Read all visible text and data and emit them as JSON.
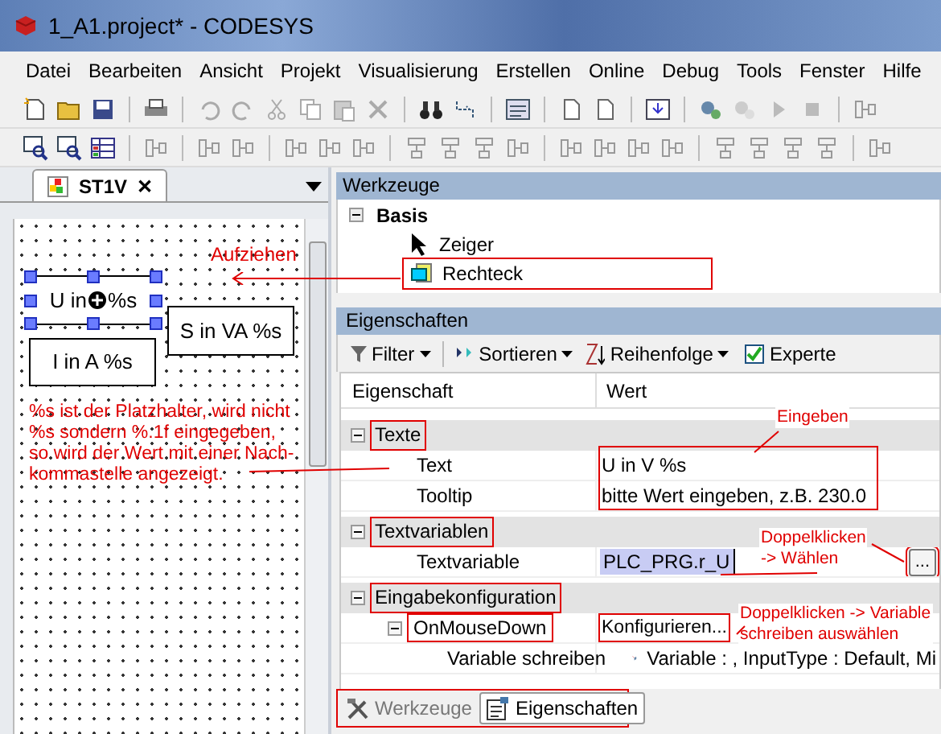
{
  "window": {
    "title": "1_A1.project* - CODESYS"
  },
  "menu": [
    {
      "label": "Datei"
    },
    {
      "label": "Bearbeiten"
    },
    {
      "label": "Ansicht"
    },
    {
      "label": "Projekt"
    },
    {
      "label": "Visualisierung"
    },
    {
      "label": "Erstellen"
    },
    {
      "label": "Online"
    },
    {
      "label": "Debug"
    },
    {
      "label": "Tools"
    },
    {
      "label": "Fenster"
    },
    {
      "label": "Hilfe"
    }
  ],
  "editor": {
    "tab": {
      "label": "ST1V",
      "close": "✕"
    },
    "elements": [
      {
        "text": "U in",
        "text_after": "%s",
        "selected": true
      },
      {
        "text": "S in VA %s",
        "selected": false
      },
      {
        "text": "I in A %s",
        "selected": false
      }
    ]
  },
  "tools": {
    "title": "Werkzeuge",
    "group": {
      "label": "Basis",
      "expanded": true
    },
    "items": [
      {
        "label": "Zeiger",
        "kind": "pointer",
        "marked": false
      },
      {
        "label": "Rechteck",
        "kind": "rectangle",
        "marked": true
      }
    ]
  },
  "properties": {
    "title": "Eigenschaften",
    "toolbar": {
      "filter": "Filter",
      "sort": "Sortieren",
      "order": "Reihenfolge",
      "expert": {
        "label": "Experte",
        "checked": true
      }
    },
    "columns": [
      "Eigenschaft",
      "Wert"
    ],
    "groups": [
      {
        "label": "Texte",
        "expanded": true,
        "marked": true,
        "values_marked": true,
        "rows": [
          {
            "kind": "text",
            "label": "Text",
            "value": "U in V %s"
          },
          {
            "kind": "text",
            "label": "Tooltip",
            "value": "bitte Wert eingeben, z.B. 230.0"
          }
        ]
      },
      {
        "label": "Textvariablen",
        "expanded": true,
        "marked": true,
        "rows": [
          {
            "kind": "variable",
            "label": "Textvariable",
            "value": "PLC_PRG.r_U",
            "value_selected": true,
            "button": "...",
            "button_marked": true
          }
        ]
      },
      {
        "label": "Eingabekonfiguration",
        "expanded": true,
        "marked": true,
        "rows": [
          {
            "kind": "event",
            "label": "OnMouseDown",
            "expanded": true,
            "marked": true,
            "value": "Konfigurieren...",
            "value_marked": true
          },
          {
            "kind": "action",
            "label": "Variable schreiben",
            "value": "Variable : , InputType : Default, Mi"
          }
        ]
      }
    ]
  },
  "bottom_tabs": {
    "marked": true,
    "tabs": [
      {
        "label": "Werkzeuge",
        "selected": false
      },
      {
        "label": "Eigenschaften",
        "selected": true
      }
    ]
  },
  "annotations": [
    {
      "kind": "label",
      "text": "Aufziehen"
    },
    {
      "kind": "paragraph",
      "lines": [
        "%s ist der Platzhalter, wird nicht",
        "%s sondern %.1f eingegeben,",
        "so wird der Wert mit einer Nach-",
        "kommastelle angezeigt."
      ]
    },
    {
      "kind": "callout",
      "lines": [
        "Eingeben"
      ]
    },
    {
      "kind": "callout",
      "lines": [
        "Doppelklicken",
        "-> Wählen"
      ]
    },
    {
      "kind": "callout",
      "lines": [
        "Doppelklicken -> Variable",
        "schreiben auswählen"
      ]
    }
  ]
}
